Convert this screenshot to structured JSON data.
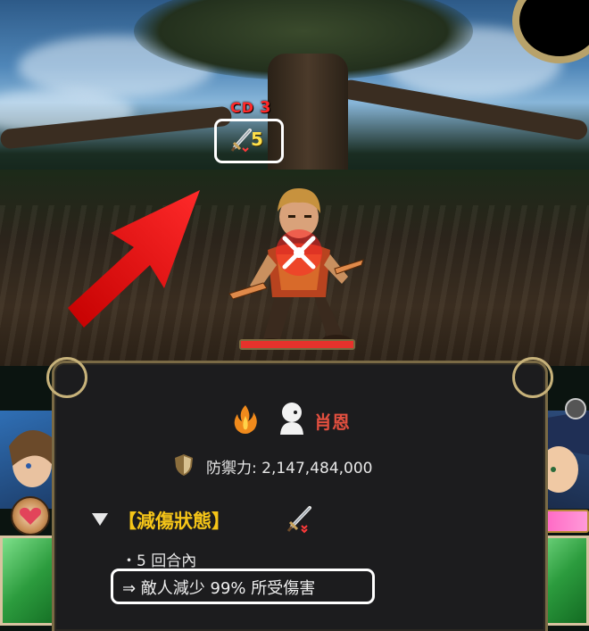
{
  "battle": {
    "cd_label": "CD",
    "cd_value": "3",
    "buff_count": "5",
    "enemy_hp_fraction": 1.0
  },
  "info_panel": {
    "enemy_name": "肖恩",
    "defense_text": "防禦力: 2,147,484,000",
    "status_title": "【減傷狀態】",
    "turns_text": "・5 回合內",
    "effect_text": "⇒ 敵人減少 99% 所受傷害"
  },
  "icons": {
    "attribute": "fire-icon",
    "race": "human-icon",
    "defense": "shield-icon",
    "status": "sword-down-icon",
    "expand": "triangle-down-icon",
    "pointer": "red-arrow"
  },
  "colors": {
    "cd_text": "#ff2a2a",
    "buff_count": "#ffe04a",
    "name": "#e14f3f",
    "status_title": "#f5c518",
    "highlight_box": "#ffffff",
    "arrow": "#ff1a1a"
  }
}
